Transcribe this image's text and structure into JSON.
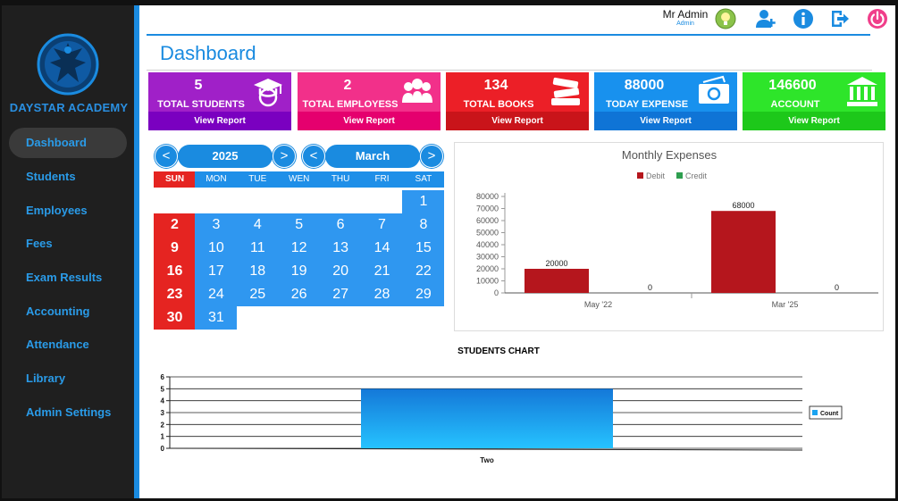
{
  "sidebar": {
    "brand": "DAYSTAR ACADEMY",
    "items": [
      {
        "label": "Dashboard",
        "active": true
      },
      {
        "label": "Students"
      },
      {
        "label": " Employees"
      },
      {
        "label": "Fees"
      },
      {
        "label": "Exam Results"
      },
      {
        "label": "Accounting"
      },
      {
        "label": "Attendance"
      },
      {
        "label": "Library"
      },
      {
        "label": "Admin Settings"
      }
    ]
  },
  "header": {
    "user_name": "Mr Admin",
    "user_role": "Admin",
    "icons": [
      "lightbulb-icon",
      "add-user-icon",
      "info-icon",
      "logout-icon",
      "power-icon"
    ]
  },
  "page_title": "Dashboard",
  "cards": [
    {
      "value": "5",
      "label": "TOTAL STUDENTS",
      "link": "View Report",
      "color": "#a020c8",
      "footer_color": "#7a00c0",
      "icon": "graduate-icon"
    },
    {
      "value": "2",
      "label": "TOTAL EMPLOYESS",
      "link": "View Report",
      "color": "#f2308a",
      "footer_color": "#e5006e",
      "icon": "group-icon"
    },
    {
      "value": "134",
      "label": "TOTAL BOOKS",
      "link": "View Report",
      "color": "#ec1f27",
      "footer_color": "#c9141a",
      "icon": "books-icon"
    },
    {
      "value": "88000",
      "label": "TODAY EXPENSE",
      "link": "View Report",
      "color": "#1891ee",
      "footer_color": "#0f74d6",
      "icon": "money-icon"
    },
    {
      "value": "146600",
      "label": "ACCOUNT",
      "link": "View Report",
      "color": "#2ee52a",
      "footer_color": "#1dc81a",
      "icon": "bank-icon"
    }
  ],
  "calendar": {
    "prev_year": "<",
    "year": "2025",
    "next_year": ">",
    "prev_month": "<",
    "month": "March",
    "next_month": ">",
    "weekdays": [
      "SUN",
      "MON",
      "TUE",
      "WEN",
      "THU",
      "FRI",
      "SAT"
    ],
    "weeks": [
      [
        "",
        "",
        "",
        "",
        "",
        "",
        "1"
      ],
      [
        "2",
        "3",
        "4",
        "5",
        "6",
        "7",
        "8"
      ],
      [
        "9",
        "10",
        "11",
        "12",
        "13",
        "14",
        "15"
      ],
      [
        "16",
        "17",
        "18",
        "19",
        "20",
        "21",
        "22"
      ],
      [
        "23",
        "24",
        "25",
        "26",
        "27",
        "28",
        "29"
      ],
      [
        "30",
        "31",
        "",
        "",
        "",
        "",
        ""
      ]
    ]
  },
  "chart_data": [
    {
      "type": "bar",
      "title": "Monthly Expenses",
      "categories": [
        "May '22",
        "Mar '25"
      ],
      "series": [
        {
          "name": "Debit",
          "values": [
            20000,
            68000
          ],
          "color": "#b5161d"
        },
        {
          "name": "Credit",
          "values": [
            0,
            0
          ],
          "color": "#2e9e4f"
        }
      ],
      "data_labels": [
        "20000",
        "0",
        "68000",
        "0"
      ],
      "ylim": [
        0,
        80000
      ],
      "yticks": [
        "0",
        "10000",
        "20000",
        "30000",
        "40000",
        "50000",
        "60000",
        "70000",
        "80000"
      ],
      "legend": "top"
    },
    {
      "type": "bar",
      "title": "STUDENTS CHART",
      "categories": [
        "Two"
      ],
      "series": [
        {
          "name": "Count",
          "values": [
            5
          ],
          "color": "#1aa3f0"
        }
      ],
      "ylim": [
        0,
        6
      ],
      "yticks": [
        "0",
        "1",
        "2",
        "3",
        "4",
        "5",
        "6"
      ],
      "grid": true,
      "legend": "right"
    }
  ]
}
